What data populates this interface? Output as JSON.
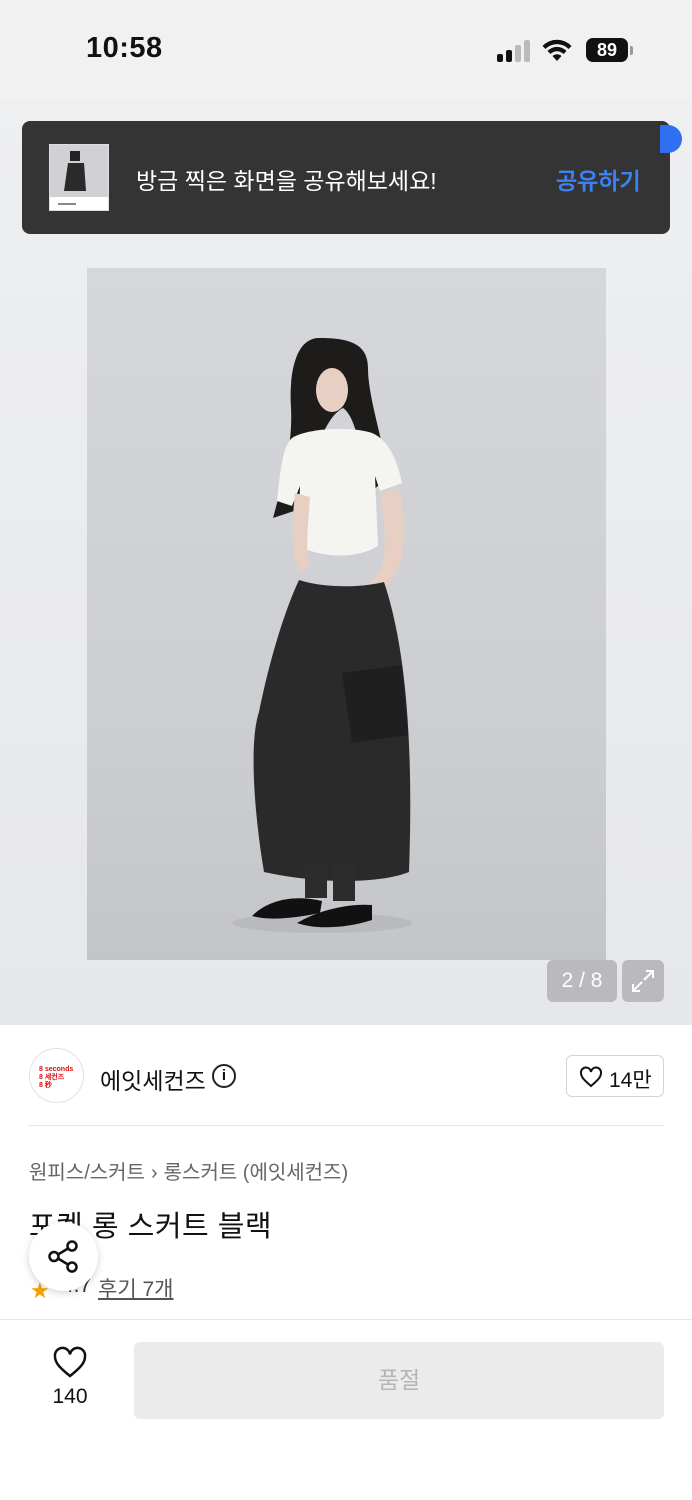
{
  "status_bar": {
    "time": "10:58",
    "battery": "89"
  },
  "toast": {
    "message": "방금 찍은 화면을 공유해보세요!",
    "action": "공유하기"
  },
  "gallery": {
    "counter": "2 / 8"
  },
  "brand": {
    "logo_lines": [
      "8 seconds",
      "8 세컨즈",
      "8 秒"
    ],
    "name": "에잇세컨즈",
    "likes": "14만"
  },
  "breadcrumb": {
    "category": "원피스/스커트",
    "separator": "›",
    "subcategory": "롱스커트 (에잇세컨즈)"
  },
  "product": {
    "title": "포켓 롱 스커트 블랙",
    "rating": "4.7",
    "reviews": "후기 7개"
  },
  "bottom_bar": {
    "wish_count": "140",
    "buy_label": "품절"
  },
  "colors": {
    "accent_blue": "#3b82f6",
    "toast_bg": "#343434",
    "star": "#f5a000"
  }
}
